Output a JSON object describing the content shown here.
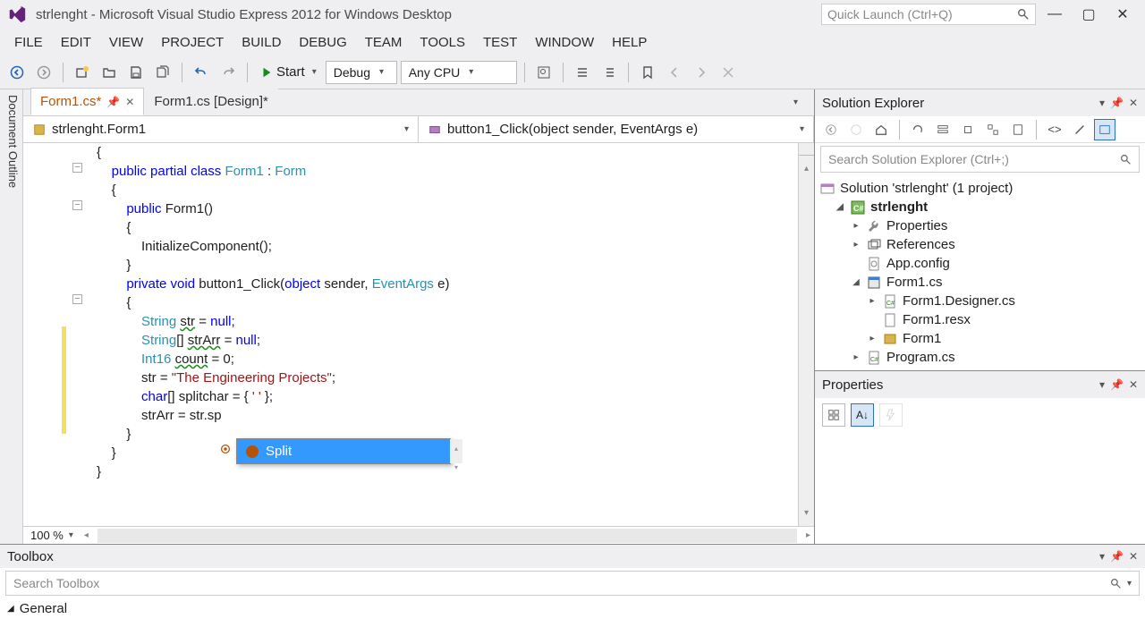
{
  "titlebar": {
    "title": "strlenght - Microsoft Visual Studio Express 2012 for Windows Desktop",
    "quick_launch_placeholder": "Quick Launch (Ctrl+Q)"
  },
  "menu": [
    "FILE",
    "EDIT",
    "VIEW",
    "PROJECT",
    "BUILD",
    "DEBUG",
    "TEAM",
    "TOOLS",
    "TEST",
    "WINDOW",
    "HELP"
  ],
  "toolbar": {
    "start_label": "Start",
    "config": "Debug",
    "platform": "Any CPU"
  },
  "tabs": {
    "active": "Form1.cs*",
    "other": "Form1.cs [Design]*"
  },
  "navbar": {
    "left": "strlenght.Form1",
    "right": "button1_Click(object sender, EventArgs e)"
  },
  "code": {
    "lines": [
      {
        "text": "{",
        "indent": 0
      },
      {
        "text": "public partial class Form1 : Form",
        "indent": 1,
        "tokens": [
          [
            "kw",
            "public"
          ],
          [
            "sp",
            " "
          ],
          [
            "kw",
            "partial"
          ],
          [
            "sp",
            " "
          ],
          [
            "kw",
            "class"
          ],
          [
            "sp",
            " "
          ],
          [
            "type",
            "Form1"
          ],
          [
            "sp",
            " "
          ],
          [
            "ident",
            ":"
          ],
          [
            "sp",
            " "
          ],
          [
            "type",
            "Form"
          ]
        ]
      },
      {
        "text": "{",
        "indent": 1
      },
      {
        "text": "public Form1()",
        "indent": 2,
        "tokens": [
          [
            "kw",
            "public"
          ],
          [
            "sp",
            " "
          ],
          [
            "ident",
            "Form1()"
          ]
        ]
      },
      {
        "text": "{",
        "indent": 2
      },
      {
        "text": "InitializeComponent();",
        "indent": 3
      },
      {
        "text": "}",
        "indent": 2
      },
      {
        "text": "",
        "indent": 0
      },
      {
        "text": "private void button1_Click(object sender, EventArgs e)",
        "indent": 2,
        "tokens": [
          [
            "kw",
            "private"
          ],
          [
            "sp",
            " "
          ],
          [
            "kw",
            "void"
          ],
          [
            "sp",
            " "
          ],
          [
            "ident",
            "button1_Click("
          ],
          [
            "kw",
            "object"
          ],
          [
            "sp",
            " "
          ],
          [
            "ident",
            "sender,"
          ],
          [
            "sp",
            " "
          ],
          [
            "type",
            "EventArgs"
          ],
          [
            "sp",
            " "
          ],
          [
            "ident",
            "e)"
          ]
        ]
      },
      {
        "text": "{",
        "indent": 2
      },
      {
        "text": "String str = null;",
        "indent": 3,
        "tokens": [
          [
            "type",
            "String"
          ],
          [
            "sp",
            " "
          ],
          [
            "wavy",
            "str"
          ],
          [
            "sp",
            " "
          ],
          [
            "ident",
            "= "
          ],
          [
            "kw",
            "null"
          ],
          [
            "ident",
            ";"
          ]
        ]
      },
      {
        "text": "String[] strArr = null;",
        "indent": 3,
        "tokens": [
          [
            "type",
            "String"
          ],
          [
            "ident",
            "[]"
          ],
          [
            "sp",
            " "
          ],
          [
            "wavy",
            "strArr"
          ],
          [
            "sp",
            " "
          ],
          [
            "ident",
            "= "
          ],
          [
            "kw",
            "null"
          ],
          [
            "ident",
            ";"
          ]
        ]
      },
      {
        "text": "Int16 count = 0;",
        "indent": 3,
        "tokens": [
          [
            "type",
            "Int16"
          ],
          [
            "sp",
            " "
          ],
          [
            "wavy",
            "count"
          ],
          [
            "sp",
            " "
          ],
          [
            "ident",
            "= 0;"
          ]
        ]
      },
      {
        "text": "str = \"The Engineering Projects\";",
        "indent": 3,
        "tokens": [
          [
            "ident",
            "str = "
          ],
          [
            "str",
            "\"The Engineering Projects\""
          ],
          [
            "ident",
            ";"
          ]
        ]
      },
      {
        "text": "char[] splitchar = { ' ' };",
        "indent": 3,
        "tokens": [
          [
            "kw",
            "char"
          ],
          [
            "ident",
            "[] splitchar = { "
          ],
          [
            "str",
            "' '"
          ],
          [
            "ident",
            " };"
          ]
        ]
      },
      {
        "text": "strArr = str.sp",
        "indent": 3,
        "tokens": [
          [
            "ident",
            "strArr = str.sp"
          ]
        ]
      },
      {
        "text": "}",
        "indent": 2
      },
      {
        "text": "}",
        "indent": 1
      },
      {
        "text": "}",
        "indent": 0
      }
    ],
    "intellisense": "Split",
    "zoom": "100 %"
  },
  "solution_explorer": {
    "title": "Solution Explorer",
    "search_placeholder": "Search Solution Explorer (Ctrl+;)",
    "root": "Solution 'strlenght' (1 project)",
    "project": "strlenght",
    "items": [
      "Properties",
      "References",
      "App.config",
      "Form1.cs"
    ],
    "form_children": [
      "Form1.Designer.cs",
      "Form1.resx",
      "Form1"
    ],
    "program": "Program.cs"
  },
  "properties": {
    "title": "Properties"
  },
  "toolbox": {
    "title": "Toolbox",
    "search_placeholder": "Search Toolbox",
    "group": "General"
  }
}
